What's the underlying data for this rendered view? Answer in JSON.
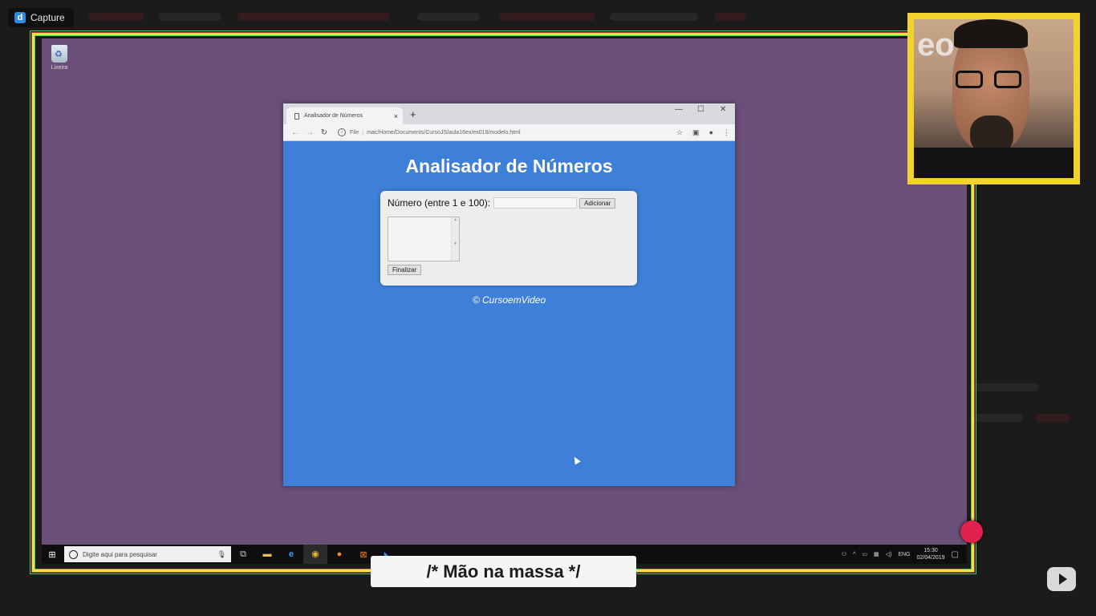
{
  "capture_badge": {
    "label": "Capture"
  },
  "desktop": {
    "recycle_bin_label": "Lixeira"
  },
  "browser": {
    "tab_title": "Analisador de Números",
    "tab_close": "×",
    "new_tab": "+",
    "window_controls": {
      "minimize": "—",
      "maximize": "☐",
      "close": "✕"
    },
    "address": {
      "scheme": "File",
      "url": "mac/Home/Documents/CursoJS/aula16ex/ex018/modelo.html"
    }
  },
  "page": {
    "title": "Analisador de Números",
    "label_numero": "Número (entre 1 e 100):",
    "numero_value": "",
    "btn_adicionar": "Adicionar",
    "btn_finalizar": "Finalizar",
    "copyright": "© CursoemVideo"
  },
  "taskbar": {
    "search_placeholder": "Digite aqui para pesquisar",
    "language": "ENG",
    "time": "15:30",
    "date": "02/04/2019"
  },
  "caption": {
    "text": "/* Mão na massa */"
  },
  "icons": [
    "capture-logo-icon",
    "recycle-bin-icon",
    "page-icon",
    "back-icon",
    "forward-icon",
    "reload-icon",
    "info-icon",
    "star-icon",
    "extension-icon",
    "account-icon",
    "menu-icon",
    "windows-start-icon",
    "cortana-icon",
    "microphone-icon",
    "task-view-icon",
    "file-explorer-icon",
    "edge-icon",
    "chrome-icon",
    "firefox-icon",
    "xampp-icon",
    "vscode-icon",
    "notification-icon",
    "youtube-play-icon"
  ]
}
